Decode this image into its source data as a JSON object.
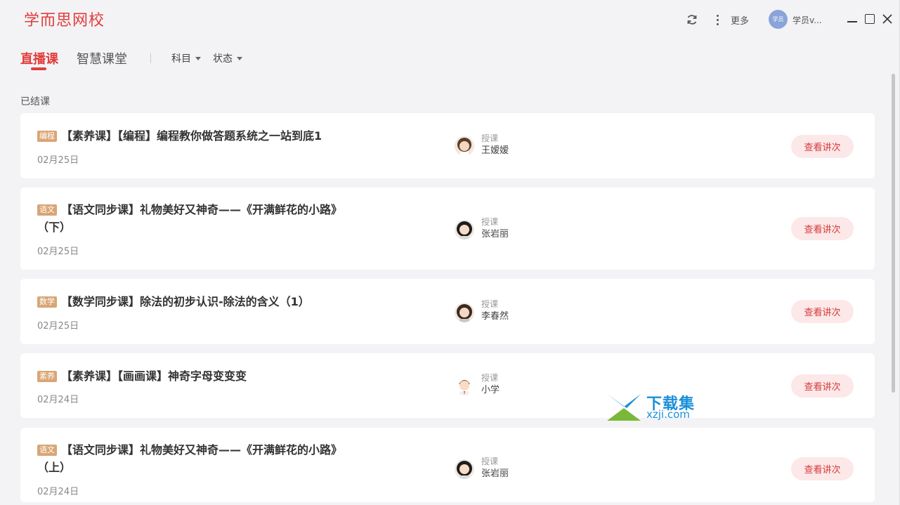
{
  "app": {
    "logo": "学而思网校",
    "more_label": "更多",
    "avatar_text": "学员",
    "user_name": "学员v..."
  },
  "tabs": {
    "live": "直播课",
    "smart": "智慧课堂"
  },
  "filters": {
    "subject": "科目",
    "status": "状态"
  },
  "section": {
    "label": "已结课"
  },
  "courses": [
    {
      "tag": "编程",
      "title": "【素养课】【编程】编程教你做答题系统之一站到底1",
      "date": "02月25日",
      "role": "授课",
      "teacher": "王嫒嫒",
      "button": "查看讲次"
    },
    {
      "tag": "语文",
      "title": "【语文同步课】礼物美好又神奇——《开满鲜花的小路》（下）",
      "date": "02月25日",
      "role": "授课",
      "teacher": "张岩丽",
      "button": "查看讲次"
    },
    {
      "tag": "数学",
      "title": "【数学同步课】除法的初步认识-除法的含义（1）",
      "date": "02月25日",
      "role": "授课",
      "teacher": "李春然",
      "button": "查看讲次"
    },
    {
      "tag": "素养",
      "title": "【素养课】【画画课】神奇字母变变变",
      "date": "02月24日",
      "role": "授课",
      "teacher": "小学",
      "button": "查看讲次"
    },
    {
      "tag": "语文",
      "title": "【语文同步课】礼物美好又神奇——《开满鲜花的小路》（上）",
      "date": "02月24日",
      "role": "授课",
      "teacher": "张岩丽",
      "button": "查看讲次"
    }
  ],
  "watermark": {
    "text": "下载集",
    "sub": "xzji.com"
  },
  "colors": {
    "brand_red": "#e23c3c",
    "tag_bg": "#d9a574",
    "button_bg": "#fce8e8"
  }
}
